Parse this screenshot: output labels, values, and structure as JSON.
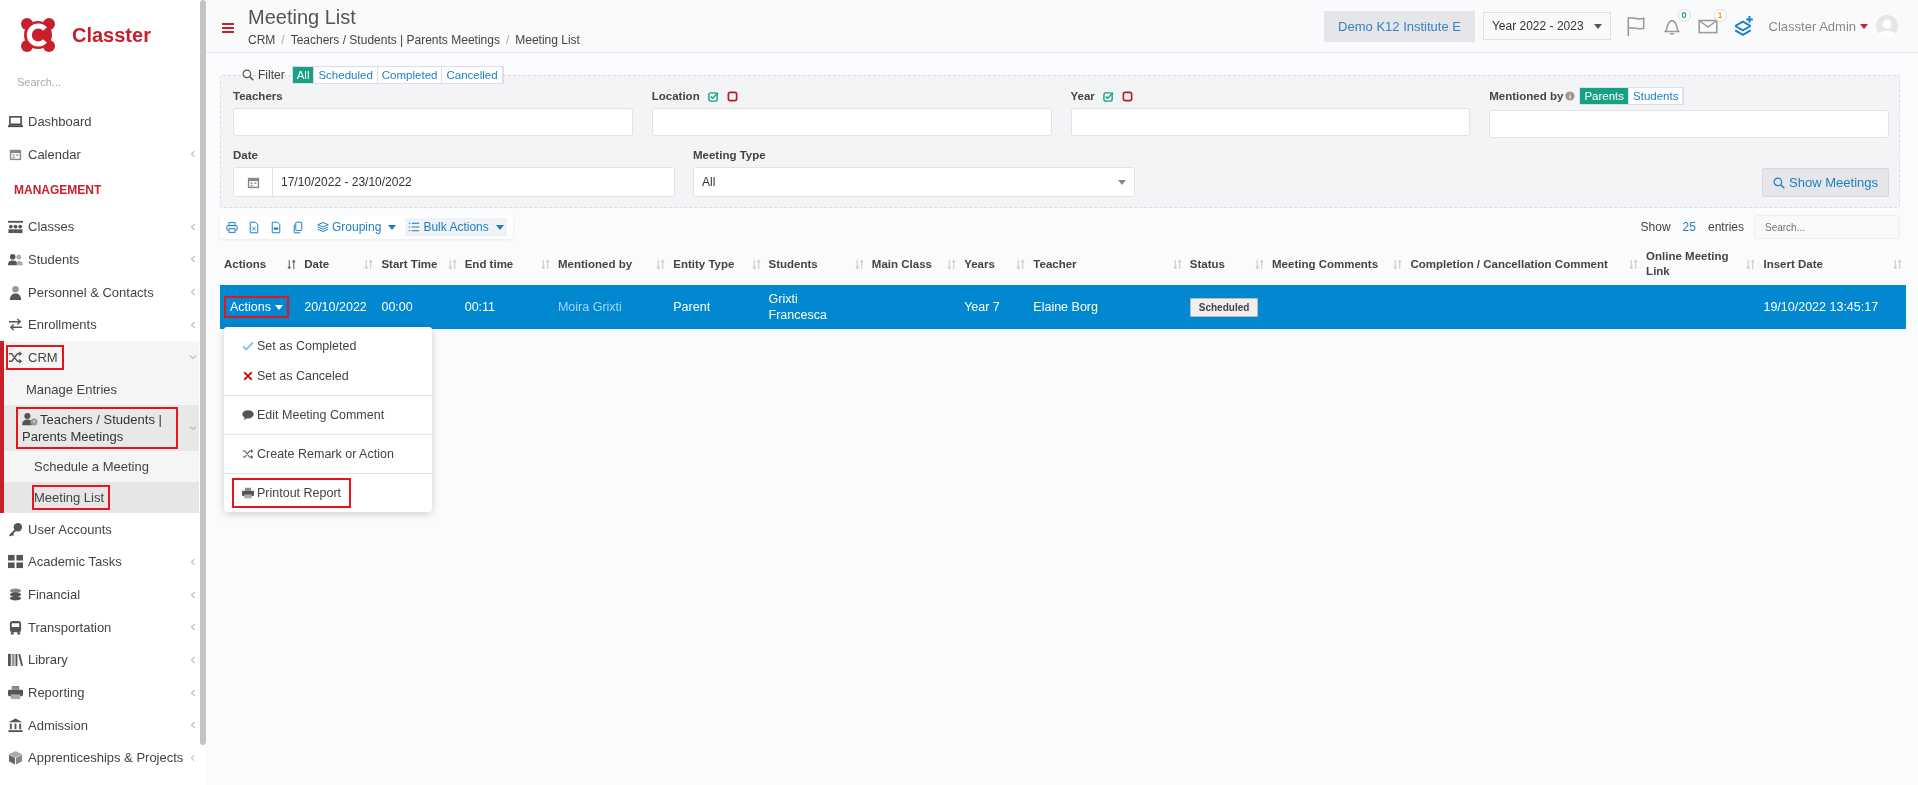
{
  "brand": {
    "name": "Classter"
  },
  "sidebar": {
    "search": {
      "placeholder": "Search..."
    },
    "items": [
      {
        "kind": "link",
        "label": "Dashboard",
        "expandable": false,
        "expanded": false,
        "highlighted": false
      },
      {
        "kind": "link",
        "label": "Calendar",
        "expandable": true,
        "expanded": false,
        "highlighted": false
      },
      {
        "kind": "section",
        "label": "MANAGEMENT"
      },
      {
        "kind": "link",
        "label": "Classes",
        "expandable": true,
        "expanded": false,
        "highlighted": false
      },
      {
        "kind": "link",
        "label": "Students",
        "expandable": true,
        "expanded": false,
        "highlighted": false
      },
      {
        "kind": "link",
        "label": "Personnel & Contacts",
        "expandable": true,
        "expanded": false,
        "highlighted": false
      },
      {
        "kind": "link",
        "label": "Enrollments",
        "expandable": true,
        "expanded": false,
        "highlighted": false
      },
      {
        "kind": "link",
        "label": "CRM",
        "expandable": true,
        "expanded": true,
        "highlighted": true,
        "children": [
          {
            "kind": "leaf",
            "label": "Manage Entries",
            "selected": false,
            "highlighted": false
          },
          {
            "kind": "group",
            "label": "Teachers / Students | Parents Meetings",
            "expanded": true,
            "highlighted": true,
            "children": [
              {
                "kind": "leaf",
                "label": "Schedule a Meeting",
                "selected": false,
                "highlighted": false
              },
              {
                "kind": "leaf",
                "label": "Meeting List",
                "selected": true,
                "highlighted": true
              }
            ]
          }
        ]
      },
      {
        "kind": "link",
        "label": "User Accounts",
        "expandable": false,
        "expanded": false,
        "highlighted": false
      },
      {
        "kind": "link",
        "label": "Academic Tasks",
        "expandable": true,
        "expanded": false,
        "highlighted": false
      },
      {
        "kind": "link",
        "label": "Financial",
        "expandable": true,
        "expanded": false,
        "highlighted": false
      },
      {
        "kind": "link",
        "label": "Transportation",
        "expandable": true,
        "expanded": false,
        "highlighted": false
      },
      {
        "kind": "link",
        "label": "Library",
        "expandable": true,
        "expanded": false,
        "highlighted": false
      },
      {
        "kind": "link",
        "label": "Reporting",
        "expandable": true,
        "expanded": false,
        "highlighted": false
      },
      {
        "kind": "link",
        "label": "Admission",
        "expandable": true,
        "expanded": false,
        "highlighted": false
      },
      {
        "kind": "link",
        "label": "Apprenticeships & Projects",
        "expandable": true,
        "expanded": false,
        "highlighted": false
      }
    ]
  },
  "header": {
    "title": "Meeting List",
    "breadcrumb": [
      "CRM",
      "Teachers / Students | Parents Meetings",
      "Meeting List"
    ],
    "breadcrumb_separator": "/",
    "institute": "Demo K12 Institute E",
    "year": "Year 2022 - 2023",
    "notifications": "0",
    "messages": "1",
    "user": "Classter Admin"
  },
  "filter": {
    "label": "Filter",
    "status_tabs": [
      {
        "label": "All",
        "selected": true
      },
      {
        "label": "Scheduled",
        "selected": false
      },
      {
        "label": "Completed",
        "selected": false
      },
      {
        "label": "Cancelled",
        "selected": false
      }
    ],
    "fields": [
      {
        "kind": "text",
        "label": "Teachers"
      },
      {
        "kind": "include_exclude",
        "label": "Location"
      },
      {
        "kind": "include_exclude",
        "label": "Year"
      },
      {
        "kind": "segmented",
        "label": "Mentioned by",
        "options": [
          {
            "label": "Parents",
            "selected": true
          },
          {
            "label": "Students",
            "selected": false
          }
        ]
      }
    ],
    "date": {
      "label": "Date",
      "value": "17/10/2022 - 23/10/2022"
    },
    "meeting_type": {
      "label": "Meeting Type",
      "value": "All"
    },
    "button": "Show Meetings"
  },
  "toolbar": {
    "grouping": "Grouping",
    "bulk_actions": "Bulk Actions",
    "show": "Show",
    "page_size": "25",
    "entries": "entries",
    "search": {
      "placeholder": "Search..."
    }
  },
  "table": {
    "columns": [
      {
        "label": "Actions",
        "sorted": true
      },
      {
        "label": "Date",
        "sorted": false
      },
      {
        "label": "Start Time",
        "sorted": false
      },
      {
        "label": "End time",
        "sorted": false
      },
      {
        "label": "Mentioned by",
        "sorted": false
      },
      {
        "label": "Entity Type",
        "sorted": false
      },
      {
        "label": "Students",
        "sorted": false
      },
      {
        "label": "Main Class",
        "sorted": false
      },
      {
        "label": "Years",
        "sorted": false
      },
      {
        "label": "Teacher",
        "sorted": false
      },
      {
        "label": "Status",
        "sorted": false
      },
      {
        "label": "Meeting Comments",
        "sorted": false
      },
      {
        "label": "Completion / Cancellation Comment",
        "sorted": false
      },
      {
        "label": "Online Meeting Link",
        "sorted": false
      },
      {
        "label": "Insert Date",
        "sorted": false
      }
    ],
    "rows": [
      {
        "selected": true,
        "actions": {
          "label": "Actions",
          "highlighted": true
        },
        "date": "20/10/2022",
        "start_time": "00:00",
        "end_time": "00:11",
        "mentioned_by": "Moira Grixti",
        "entity_type": "Parent",
        "students": "Grixti Francesca",
        "years": "Year 7",
        "teacher": "Elaine Borg",
        "status": "Scheduled",
        "insert_date": "19/10/2022 13:45:17"
      }
    ]
  },
  "actions_menu": {
    "items": [
      {
        "kind": "item",
        "label": "Set as Completed",
        "highlighted": false
      },
      {
        "kind": "item",
        "label": "Set as Canceled",
        "highlighted": false
      },
      {
        "kind": "divider"
      },
      {
        "kind": "item",
        "label": "Edit Meeting Comment",
        "highlighted": false
      },
      {
        "kind": "divider"
      },
      {
        "kind": "item",
        "label": "Create Remark or Action",
        "highlighted": false
      },
      {
        "kind": "divider"
      },
      {
        "kind": "item",
        "label": "Printout Report",
        "highlighted": true
      }
    ]
  }
}
